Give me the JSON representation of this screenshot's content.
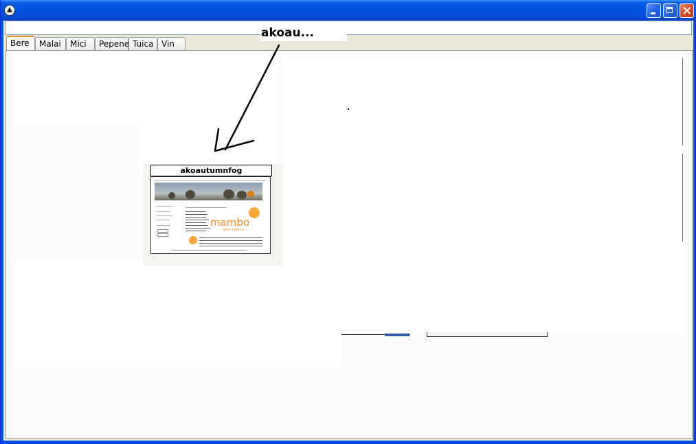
{
  "window": {
    "title": "",
    "address_value": ""
  },
  "tabs": [
    {
      "label": "Bere",
      "active": true
    },
    {
      "label": "Malai",
      "active": false
    },
    {
      "label": "Mici",
      "active": false
    },
    {
      "label": "Pepene",
      "active": false
    },
    {
      "label": "Tuica",
      "active": false
    },
    {
      "label": "Vin",
      "active": false
    }
  ],
  "annotation": {
    "callout_text": "akoau..."
  },
  "thumbnail": {
    "label": "akoautumnfog",
    "logo_text": "mambo",
    "logo_sub": "open source"
  },
  "colors": {
    "titlebar": "#0054e3",
    "tab_active_accent": "#e68b2c",
    "logo": "#ff8c22"
  }
}
